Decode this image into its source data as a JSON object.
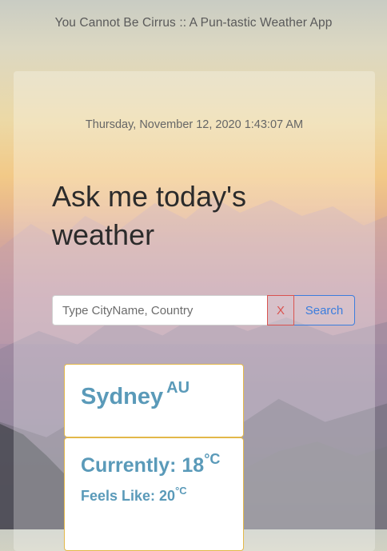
{
  "app": {
    "title": "You Cannot Be Cirrus :: A Pun-tastic Weather App"
  },
  "datetime": "Thursday, November 12, 2020 1:43:07 AM",
  "heading": "Ask me today's weather",
  "search": {
    "placeholder": "Type CityName, Country",
    "value": "",
    "clear_label": "X",
    "search_label": "Search"
  },
  "location": {
    "city": "Sydney",
    "country": "AU"
  },
  "weather": {
    "currently_label": "Currently: 18",
    "feels_label": "Feels Like: 20",
    "unit": "°C"
  },
  "colors": {
    "accent_text": "#5a9ab9",
    "card_border": "#e3b84a",
    "clear_button": "#d9534f",
    "search_button": "#3b7ddd"
  }
}
